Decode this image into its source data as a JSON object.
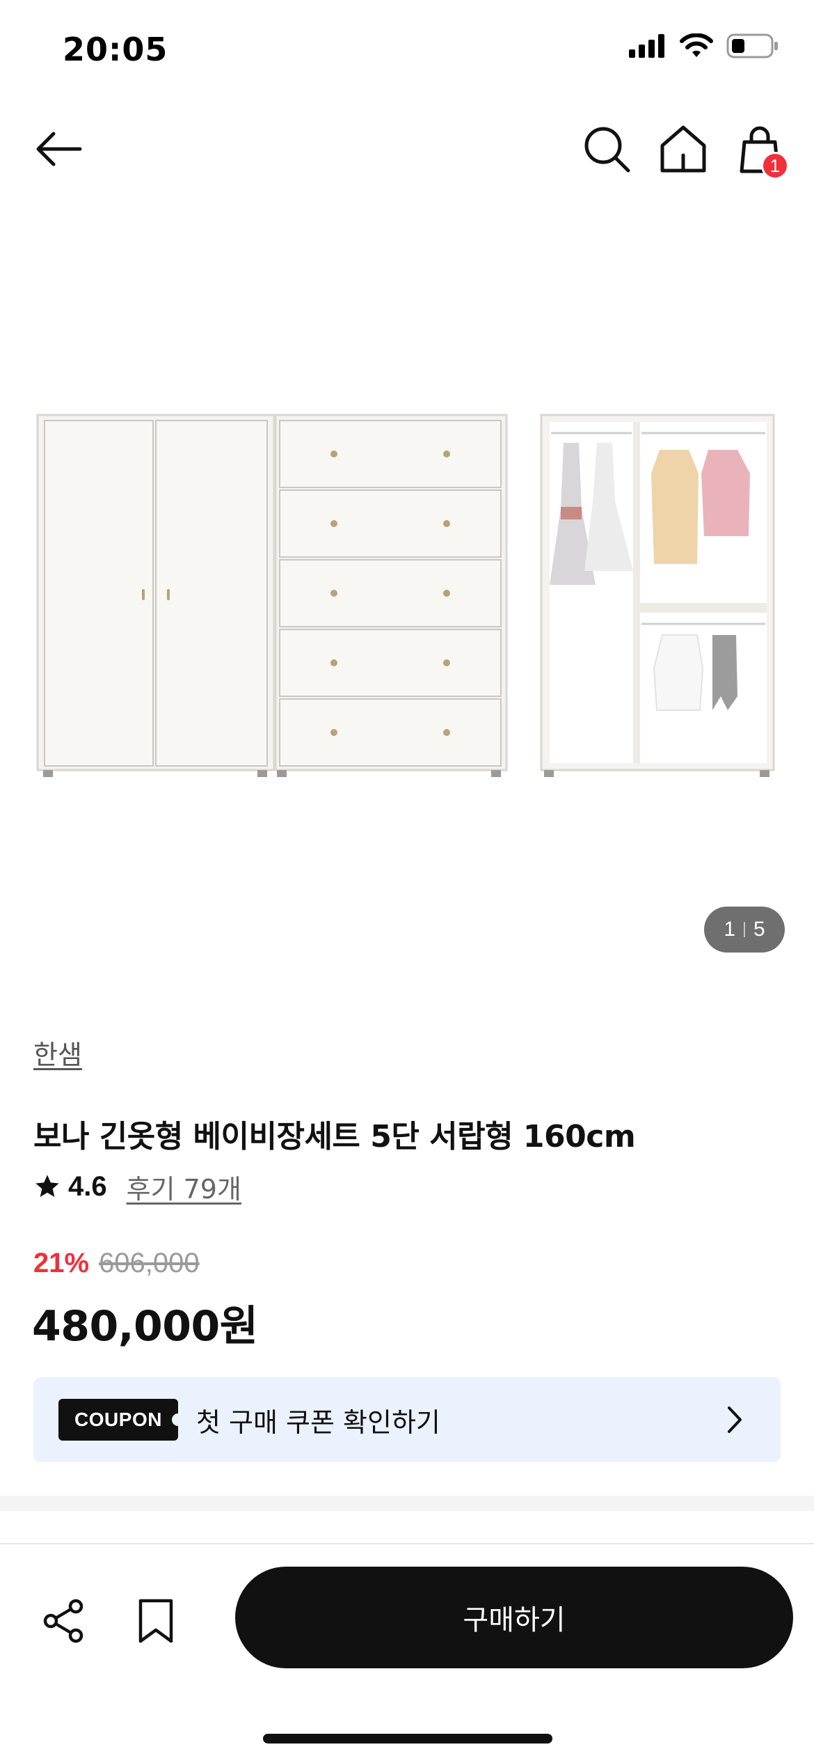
{
  "status_bar": {
    "time": "20:05",
    "icons": [
      "signal-icon",
      "wifi-icon",
      "battery-icon"
    ]
  },
  "nav": {
    "back_icon": "arrow-left-icon",
    "search_icon": "search-icon",
    "home_icon": "home-icon",
    "cart_icon": "shopping-bag-icon",
    "cart_count": "1"
  },
  "gallery": {
    "current": "1",
    "total": "5"
  },
  "product": {
    "brand": "한샘",
    "title": "보나 긴옷형 베이비장세트 5단 서랍형 160cm",
    "rating": "4.6",
    "review_label": "후기 79개",
    "discount": "21%",
    "original_price": "606,000",
    "sale_price": "480,000원"
  },
  "coupon": {
    "tag": "COUPON",
    "text": "첫 구매 쿠폰 확인하기"
  },
  "bottom_bar": {
    "share_icon": "share-icon",
    "bookmark_icon": "bookmark-icon",
    "buy_label": "구매하기"
  },
  "colors": {
    "accent_red": "#f0303a",
    "coupon_bg": "#ebf2fd",
    "primary_black": "#111111"
  }
}
